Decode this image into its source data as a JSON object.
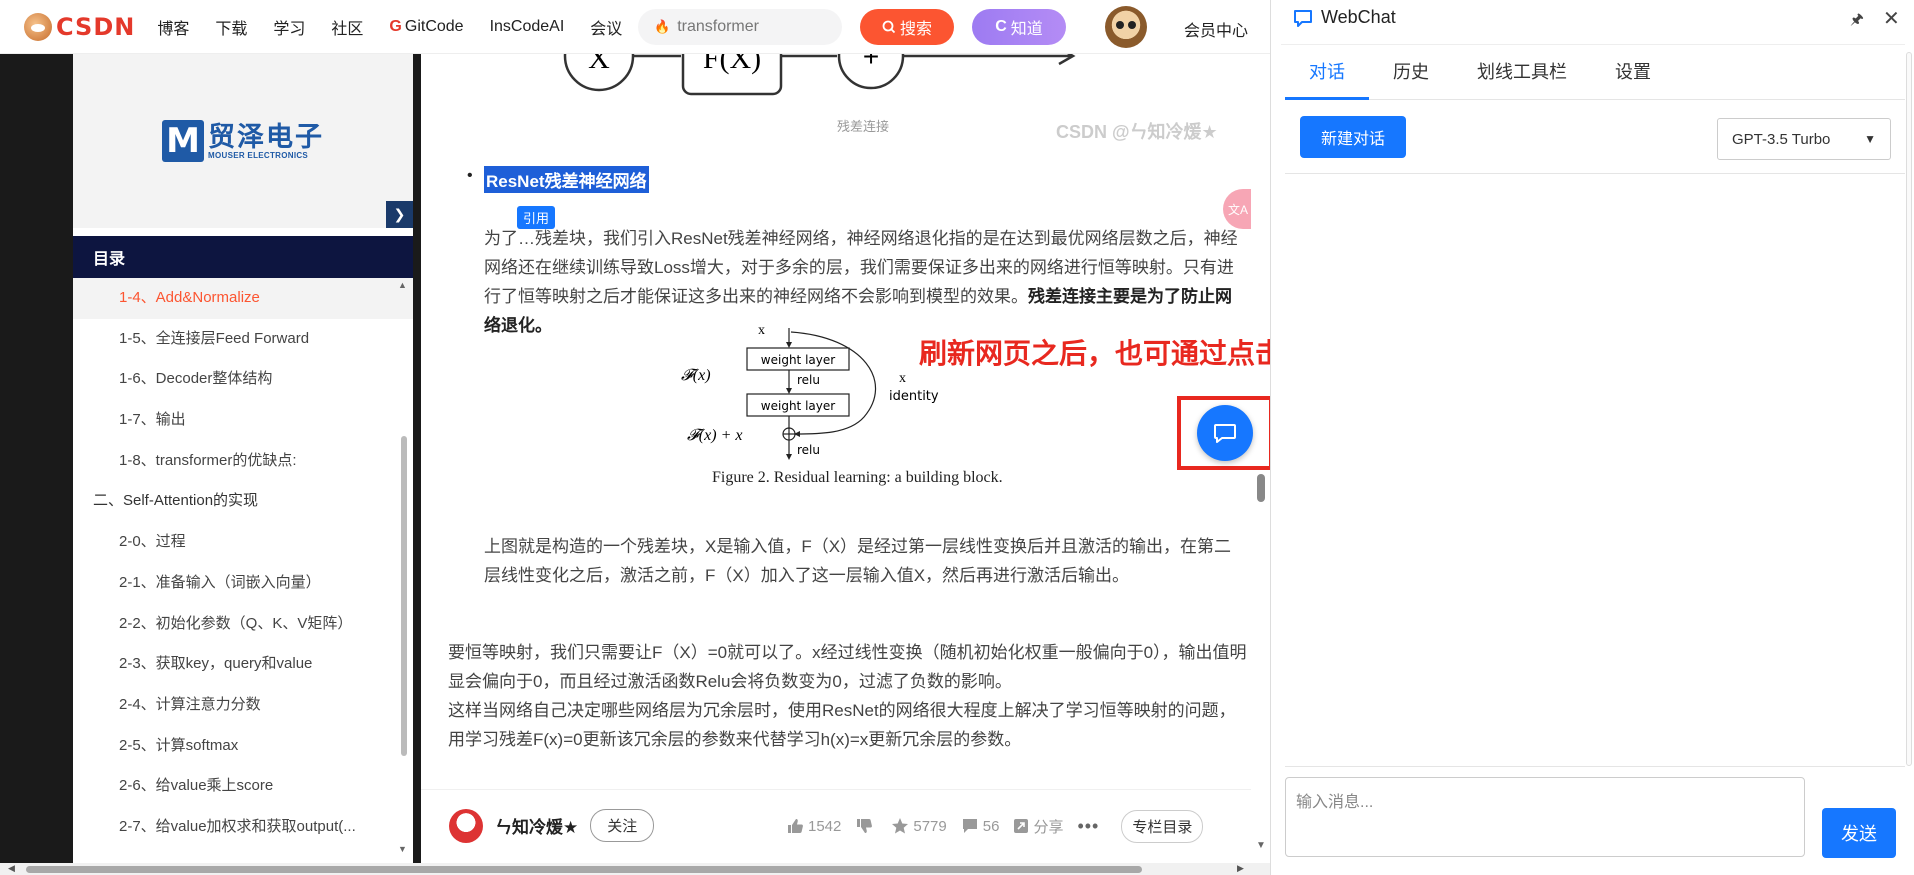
{
  "nav": {
    "logo_text": "CSDN",
    "items": [
      "博客",
      "下载",
      "学习",
      "社区",
      "GitCode",
      "InsCodeAI",
      "会议"
    ],
    "search_value": "transformer",
    "search_button": "搜索",
    "zhidao_button": "知道",
    "vip": "会员中心"
  },
  "ad": {
    "cn": "贸泽电子",
    "en": "MOUSER ELECTRONICS"
  },
  "toc": {
    "title": "目录",
    "items": [
      "1-4、Add&Normalize",
      "1-5、全连接层Feed Forward",
      "1-6、Decoder整体结构",
      "1-7、输出",
      "1-8、transformer的优缺点:",
      "二、Self-Attention的实现",
      "2-0、过程",
      "2-1、准备输入（词嵌入向量）",
      "2-2、初始化参数（Q、K、V矩阵）",
      "2-3、获取key，query和value",
      "2-4、计算注意力分数",
      "2-5、计算softmax",
      "2-6、给value乘上score",
      "2-7、给value加权求和获取output(..."
    ]
  },
  "article": {
    "fig1_x": "X",
    "fig1_fx": "F(X)",
    "fig1_plus": "+",
    "fig1_caption": "残差连接",
    "watermark": "CSDN @ㄣ知冷煖★",
    "heading": "ResNet残差神经网络",
    "quote_tag": "引用",
    "para1": "为了…残差块，我们引入ResNet残差神经网络，神经网络退化指的是在达到最优网络层数之后，神经网络还在继续训练导致Loss增大，对于多余的层，我们需要保证多出来的网络进行恒等映射。只有进行了恒等映射之后才能保证这多出来的神经网络不会影响到模型的效果。",
    "para1_bold": "残差连接主要是为了防止网络退化。",
    "fig2": {
      "x_top": "x",
      "weight1": "weight layer",
      "relu1": "relu",
      "weight2": "weight layer",
      "fx": "𝓕(x)",
      "fx_plus_x": "𝓕(x) + x",
      "x_side": "x",
      "identity": "identity",
      "relu2": "relu",
      "caption": "Figure 2. Residual learning: a building block."
    },
    "para2": "上图就是构造的一个残差块，X是输入值，F（X）是经过第一层线性变换后并且激活的输出，在第二层线性变化之后，激活之前，F（X）加入了这一层输入值X，然后再进行激活后输出。",
    "para3": "要恒等映射，我们只需要让F（X）=0就可以了。x经过线性变换（随机初始化权重一般偏向于0），输出值明显会偏向于0，而且经过激活函数Relu会将负数变为0，过滤了负数的影响。",
    "para4": "这样当网络自己决定哪些网络层为冗余层时，使用ResNet的网络很大程度上解决了学习恒等映射的问题，用学习残差F(x)=0更新该冗余层的参数来代替学习h(x)=x更新冗余层的参数。"
  },
  "annotation": "刷新网页之后，也可通过点击悬浮按钮打开侧边栏",
  "toolbar": {
    "author": "ㄣ知冷煖★",
    "follow": "关注",
    "likes": "1542",
    "stars": "5779",
    "comments": "56",
    "share": "分享",
    "more": "•••",
    "column": "专栏目录"
  },
  "webchat": {
    "title": "WebChat",
    "tabs": [
      "对话",
      "历史",
      "划线工具栏",
      "设置"
    ],
    "new_chat": "新建对话",
    "model": "GPT-3.5 Turbo",
    "input_placeholder": "输入消息...",
    "send": "发送"
  },
  "colors": {
    "csdn_red": "#fc5531",
    "accent_blue": "#1677ff",
    "annotation_red": "#e8281f",
    "toc_head": "#0d1540"
  }
}
